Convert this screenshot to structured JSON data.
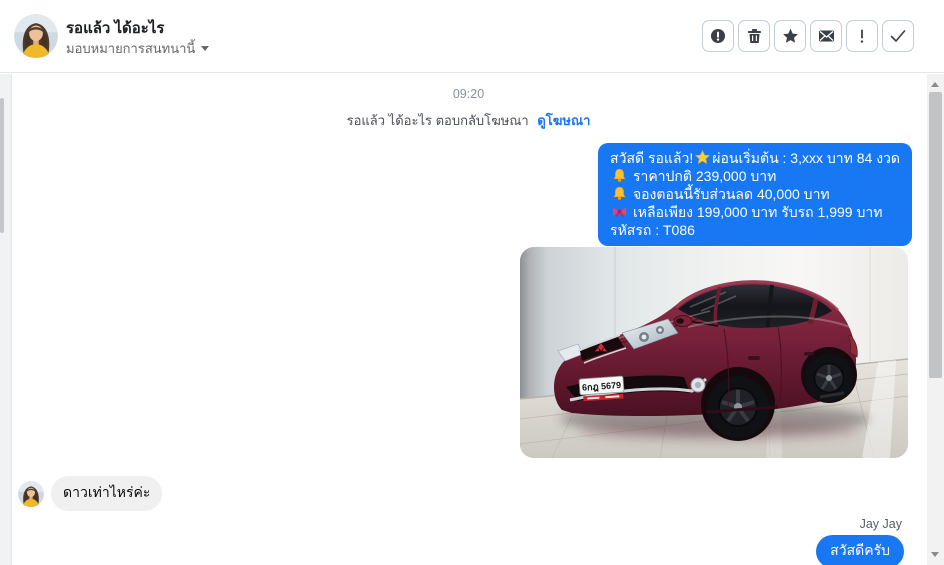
{
  "header": {
    "name": "รอแล้ว ได้อะไร",
    "assign_label": "มอบหมายการสนทนานี้",
    "action_icons": [
      "report-circle-icon",
      "trash-icon",
      "star-icon",
      "mark-unread-envelope-icon",
      "exclamation-icon",
      "done-check-icon"
    ]
  },
  "conversation": {
    "timestamp": "09:20",
    "system_event": {
      "text": "รอแล้ว ได้อะไร ตอบกลับโฆษณา",
      "link_label": "ดูโฆษณา"
    },
    "ad_reply_bubble": {
      "lines": [
        {
          "pre": "สวัสดี รอแล้ว!",
          "icon": "star-icon",
          "text": "ผ่อนเริ่มต้น : 3,xxx บาท 84 งวด"
        },
        {
          "icon": "bell-icon",
          "text": "ราคาปกติ 239,000 บาท"
        },
        {
          "icon": "bell-icon",
          "text": "จองตอนนี้รับส่วนลด 40,000 บาท"
        },
        {
          "icon": "ribbon-icon",
          "text": "เหลือเพียง 199,000 บาท รับรถ 1,999 บาท"
        },
        {
          "pre": "",
          "text": "รหัสรถ : T086"
        }
      ]
    },
    "car_photo": {
      "license_plate": "6กฎ 5679",
      "description": "maroon hatchback in showroom"
    },
    "customer_message": {
      "text": "ดาวเท่าไหร่ค่ะ"
    },
    "agent_reply": {
      "sender": "Jay Jay",
      "text": "สวัสดีครับ"
    }
  },
  "colors": {
    "bubble_blue": "#1877f2",
    "bubble_gray": "#f0f0f0",
    "link_blue": "#1877f2",
    "car_body": "#76203a"
  }
}
